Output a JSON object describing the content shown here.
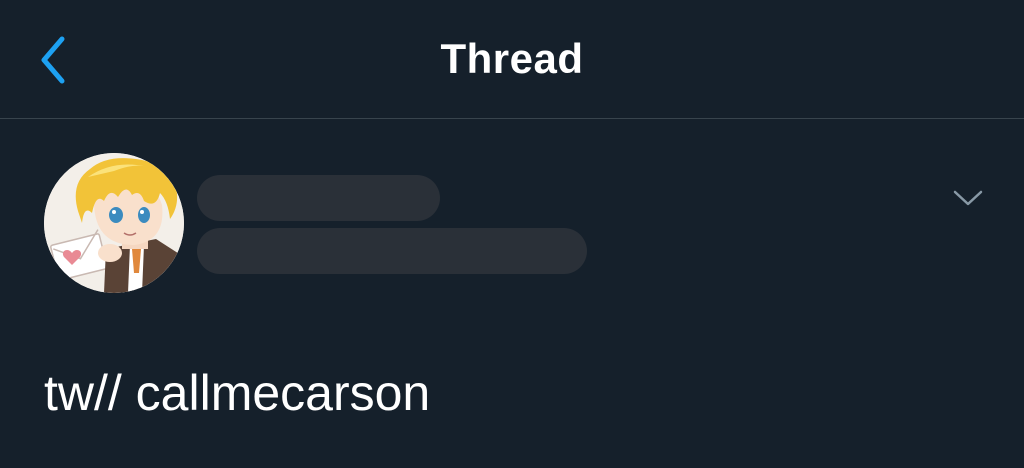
{
  "header": {
    "title": "Thread",
    "back_icon": "chevron-left-icon",
    "accent_color": "#1da1f2"
  },
  "tweet": {
    "avatar_icon": "anime-avatar",
    "name_redacted": true,
    "handle_redacted": true,
    "more_icon": "chevron-down-icon",
    "text": "tw// callmecarson"
  },
  "colors": {
    "background": "#15202b",
    "divider": "#38444d",
    "redaction": "#2a3038",
    "text": "#ffffff",
    "muted_icon": "#8899a6"
  }
}
